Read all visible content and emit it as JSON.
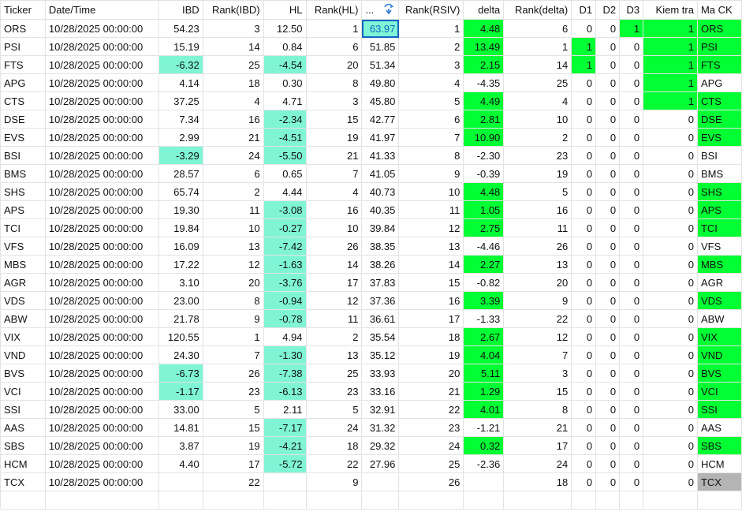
{
  "colors": {
    "teal": "#7ff5d6",
    "green": "#00ff33",
    "gray": "#b4b4b4",
    "selected_text": "#1565c0"
  },
  "headers": [
    "Ticker",
    "Date/Time",
    "IBD",
    "Rank(IBD)",
    "HL",
    "Rank(HL)",
    "...",
    "Rank(RSIV)",
    "delta",
    "Rank(delta)",
    "D1",
    "D2",
    "D3",
    "Kiem tra",
    "Ma CK"
  ],
  "sort_icon": "sort-descending-icon",
  "rows": [
    {
      "ticker": "ORS",
      "date": "10/28/2025 00:00:00",
      "ibd": "54.23",
      "rank_ibd": "3",
      "hl": "12.50",
      "rank_hl": "1",
      "rsiv": "63.97",
      "rank_rsiv": "1",
      "delta": "4.48",
      "rank_delta": "6",
      "d1": "0",
      "d2": "0",
      "d3": "1",
      "kiem_tra": "1",
      "ma_ck": "ORS",
      "hl_ibd": "",
      "hl_hl": "",
      "hl_delta": "green",
      "hl_d1": "",
      "hl_d3": "green",
      "hl_kiem": "green",
      "hl_mack": "green",
      "rsiv_selected": true
    },
    {
      "ticker": "PSI",
      "date": "10/28/2025 00:00:00",
      "ibd": "15.19",
      "rank_ibd": "14",
      "hl": "0.84",
      "rank_hl": "6",
      "rsiv": "51.85",
      "rank_rsiv": "2",
      "delta": "13.49",
      "rank_delta": "1",
      "d1": "1",
      "d2": "0",
      "d3": "0",
      "kiem_tra": "1",
      "ma_ck": "PSI",
      "hl_ibd": "",
      "hl_hl": "",
      "hl_delta": "green",
      "hl_d1": "green",
      "hl_d3": "",
      "hl_kiem": "green",
      "hl_mack": "green",
      "rsiv_selected": false
    },
    {
      "ticker": "FTS",
      "date": "10/28/2025 00:00:00",
      "ibd": "-6.32",
      "rank_ibd": "25",
      "hl": "-4.54",
      "rank_hl": "20",
      "rsiv": "51.34",
      "rank_rsiv": "3",
      "delta": "2.15",
      "rank_delta": "14",
      "d1": "1",
      "d2": "0",
      "d3": "0",
      "kiem_tra": "1",
      "ma_ck": "FTS",
      "hl_ibd": "teal",
      "hl_hl": "teal",
      "hl_delta": "green",
      "hl_d1": "green",
      "hl_d3": "",
      "hl_kiem": "green",
      "hl_mack": "green",
      "rsiv_selected": false
    },
    {
      "ticker": "APG",
      "date": "10/28/2025 00:00:00",
      "ibd": "4.14",
      "rank_ibd": "18",
      "hl": "0.30",
      "rank_hl": "8",
      "rsiv": "49.80",
      "rank_rsiv": "4",
      "delta": "-4.35",
      "rank_delta": "25",
      "d1": "0",
      "d2": "0",
      "d3": "0",
      "kiem_tra": "1",
      "ma_ck": "APG",
      "hl_ibd": "",
      "hl_hl": "",
      "hl_delta": "",
      "hl_d1": "",
      "hl_d3": "",
      "hl_kiem": "green",
      "hl_mack": "",
      "rsiv_selected": false
    },
    {
      "ticker": "CTS",
      "date": "10/28/2025 00:00:00",
      "ibd": "37.25",
      "rank_ibd": "4",
      "hl": "4.71",
      "rank_hl": "3",
      "rsiv": "45.80",
      "rank_rsiv": "5",
      "delta": "4.49",
      "rank_delta": "4",
      "d1": "0",
      "d2": "0",
      "d3": "0",
      "kiem_tra": "1",
      "ma_ck": "CTS",
      "hl_ibd": "",
      "hl_hl": "",
      "hl_delta": "green",
      "hl_d1": "",
      "hl_d3": "",
      "hl_kiem": "green",
      "hl_mack": "green",
      "rsiv_selected": false
    },
    {
      "ticker": "DSE",
      "date": "10/28/2025 00:00:00",
      "ibd": "7.34",
      "rank_ibd": "16",
      "hl": "-2.34",
      "rank_hl": "15",
      "rsiv": "42.77",
      "rank_rsiv": "6",
      "delta": "2.81",
      "rank_delta": "10",
      "d1": "0",
      "d2": "0",
      "d3": "0",
      "kiem_tra": "0",
      "ma_ck": "DSE",
      "hl_ibd": "",
      "hl_hl": "teal",
      "hl_delta": "green",
      "hl_d1": "",
      "hl_d3": "",
      "hl_kiem": "",
      "hl_mack": "green",
      "rsiv_selected": false
    },
    {
      "ticker": "EVS",
      "date": "10/28/2025 00:00:00",
      "ibd": "2.99",
      "rank_ibd": "21",
      "hl": "-4.51",
      "rank_hl": "19",
      "rsiv": "41.97",
      "rank_rsiv": "7",
      "delta": "10.90",
      "rank_delta": "2",
      "d1": "0",
      "d2": "0",
      "d3": "0",
      "kiem_tra": "0",
      "ma_ck": "EVS",
      "hl_ibd": "",
      "hl_hl": "teal",
      "hl_delta": "green",
      "hl_d1": "",
      "hl_d3": "",
      "hl_kiem": "",
      "hl_mack": "green",
      "rsiv_selected": false
    },
    {
      "ticker": "BSI",
      "date": "10/28/2025 00:00:00",
      "ibd": "-3.29",
      "rank_ibd": "24",
      "hl": "-5.50",
      "rank_hl": "21",
      "rsiv": "41.33",
      "rank_rsiv": "8",
      "delta": "-2.30",
      "rank_delta": "23",
      "d1": "0",
      "d2": "0",
      "d3": "0",
      "kiem_tra": "0",
      "ma_ck": "BSI",
      "hl_ibd": "teal",
      "hl_hl": "teal",
      "hl_delta": "",
      "hl_d1": "",
      "hl_d3": "",
      "hl_kiem": "",
      "hl_mack": "",
      "rsiv_selected": false
    },
    {
      "ticker": "BMS",
      "date": "10/28/2025 00:00:00",
      "ibd": "28.57",
      "rank_ibd": "6",
      "hl": "0.65",
      "rank_hl": "7",
      "rsiv": "41.05",
      "rank_rsiv": "9",
      "delta": "-0.39",
      "rank_delta": "19",
      "d1": "0",
      "d2": "0",
      "d3": "0",
      "kiem_tra": "0",
      "ma_ck": "BMS",
      "hl_ibd": "",
      "hl_hl": "",
      "hl_delta": "",
      "hl_d1": "",
      "hl_d3": "",
      "hl_kiem": "",
      "hl_mack": "",
      "rsiv_selected": false
    },
    {
      "ticker": "SHS",
      "date": "10/28/2025 00:00:00",
      "ibd": "65.74",
      "rank_ibd": "2",
      "hl": "4.44",
      "rank_hl": "4",
      "rsiv": "40.73",
      "rank_rsiv": "10",
      "delta": "4.48",
      "rank_delta": "5",
      "d1": "0",
      "d2": "0",
      "d3": "0",
      "kiem_tra": "0",
      "ma_ck": "SHS",
      "hl_ibd": "",
      "hl_hl": "",
      "hl_delta": "green",
      "hl_d1": "",
      "hl_d3": "",
      "hl_kiem": "",
      "hl_mack": "green",
      "rsiv_selected": false
    },
    {
      "ticker": "APS",
      "date": "10/28/2025 00:00:00",
      "ibd": "19.30",
      "rank_ibd": "11",
      "hl": "-3.08",
      "rank_hl": "16",
      "rsiv": "40.35",
      "rank_rsiv": "11",
      "delta": "1.05",
      "rank_delta": "16",
      "d1": "0",
      "d2": "0",
      "d3": "0",
      "kiem_tra": "0",
      "ma_ck": "APS",
      "hl_ibd": "",
      "hl_hl": "teal",
      "hl_delta": "green",
      "hl_d1": "",
      "hl_d3": "",
      "hl_kiem": "",
      "hl_mack": "green",
      "rsiv_selected": false
    },
    {
      "ticker": "TCI",
      "date": "10/28/2025 00:00:00",
      "ibd": "19.84",
      "rank_ibd": "10",
      "hl": "-0.27",
      "rank_hl": "10",
      "rsiv": "39.84",
      "rank_rsiv": "12",
      "delta": "2.75",
      "rank_delta": "11",
      "d1": "0",
      "d2": "0",
      "d3": "0",
      "kiem_tra": "0",
      "ma_ck": "TCI",
      "hl_ibd": "",
      "hl_hl": "teal",
      "hl_delta": "green",
      "hl_d1": "",
      "hl_d3": "",
      "hl_kiem": "",
      "hl_mack": "green",
      "rsiv_selected": false
    },
    {
      "ticker": "VFS",
      "date": "10/28/2025 00:00:00",
      "ibd": "16.09",
      "rank_ibd": "13",
      "hl": "-7.42",
      "rank_hl": "26",
      "rsiv": "38.35",
      "rank_rsiv": "13",
      "delta": "-4.46",
      "rank_delta": "26",
      "d1": "0",
      "d2": "0",
      "d3": "0",
      "kiem_tra": "0",
      "ma_ck": "VFS",
      "hl_ibd": "",
      "hl_hl": "teal",
      "hl_delta": "",
      "hl_d1": "",
      "hl_d3": "",
      "hl_kiem": "",
      "hl_mack": "",
      "rsiv_selected": false
    },
    {
      "ticker": "MBS",
      "date": "10/28/2025 00:00:00",
      "ibd": "17.22",
      "rank_ibd": "12",
      "hl": "-1.63",
      "rank_hl": "14",
      "rsiv": "38.26",
      "rank_rsiv": "14",
      "delta": "2.27",
      "rank_delta": "13",
      "d1": "0",
      "d2": "0",
      "d3": "0",
      "kiem_tra": "0",
      "ma_ck": "MBS",
      "hl_ibd": "",
      "hl_hl": "teal",
      "hl_delta": "green",
      "hl_d1": "",
      "hl_d3": "",
      "hl_kiem": "",
      "hl_mack": "green",
      "rsiv_selected": false
    },
    {
      "ticker": "AGR",
      "date": "10/28/2025 00:00:00",
      "ibd": "3.10",
      "rank_ibd": "20",
      "hl": "-3.76",
      "rank_hl": "17",
      "rsiv": "37.83",
      "rank_rsiv": "15",
      "delta": "-0.82",
      "rank_delta": "20",
      "d1": "0",
      "d2": "0",
      "d3": "0",
      "kiem_tra": "0",
      "ma_ck": "AGR",
      "hl_ibd": "",
      "hl_hl": "teal",
      "hl_delta": "",
      "hl_d1": "",
      "hl_d3": "",
      "hl_kiem": "",
      "hl_mack": "",
      "rsiv_selected": false
    },
    {
      "ticker": "VDS",
      "date": "10/28/2025 00:00:00",
      "ibd": "23.00",
      "rank_ibd": "8",
      "hl": "-0.94",
      "rank_hl": "12",
      "rsiv": "37.36",
      "rank_rsiv": "16",
      "delta": "3.39",
      "rank_delta": "9",
      "d1": "0",
      "d2": "0",
      "d3": "0",
      "kiem_tra": "0",
      "ma_ck": "VDS",
      "hl_ibd": "",
      "hl_hl": "teal",
      "hl_delta": "green",
      "hl_d1": "",
      "hl_d3": "",
      "hl_kiem": "",
      "hl_mack": "green",
      "rsiv_selected": false
    },
    {
      "ticker": "ABW",
      "date": "10/28/2025 00:00:00",
      "ibd": "21.78",
      "rank_ibd": "9",
      "hl": "-0.78",
      "rank_hl": "11",
      "rsiv": "36.61",
      "rank_rsiv": "17",
      "delta": "-1.33",
      "rank_delta": "22",
      "d1": "0",
      "d2": "0",
      "d3": "0",
      "kiem_tra": "0",
      "ma_ck": "ABW",
      "hl_ibd": "",
      "hl_hl": "teal",
      "hl_delta": "",
      "hl_d1": "",
      "hl_d3": "",
      "hl_kiem": "",
      "hl_mack": "",
      "rsiv_selected": false
    },
    {
      "ticker": "VIX",
      "date": "10/28/2025 00:00:00",
      "ibd": "120.55",
      "rank_ibd": "1",
      "hl": "4.94",
      "rank_hl": "2",
      "rsiv": "35.54",
      "rank_rsiv": "18",
      "delta": "2.67",
      "rank_delta": "12",
      "d1": "0",
      "d2": "0",
      "d3": "0",
      "kiem_tra": "0",
      "ma_ck": "VIX",
      "hl_ibd": "",
      "hl_hl": "",
      "hl_delta": "green",
      "hl_d1": "",
      "hl_d3": "",
      "hl_kiem": "",
      "hl_mack": "green",
      "rsiv_selected": false
    },
    {
      "ticker": "VND",
      "date": "10/28/2025 00:00:00",
      "ibd": "24.30",
      "rank_ibd": "7",
      "hl": "-1.30",
      "rank_hl": "13",
      "rsiv": "35.12",
      "rank_rsiv": "19",
      "delta": "4.04",
      "rank_delta": "7",
      "d1": "0",
      "d2": "0",
      "d3": "0",
      "kiem_tra": "0",
      "ma_ck": "VND",
      "hl_ibd": "",
      "hl_hl": "teal",
      "hl_delta": "green",
      "hl_d1": "",
      "hl_d3": "",
      "hl_kiem": "",
      "hl_mack": "green",
      "rsiv_selected": false
    },
    {
      "ticker": "BVS",
      "date": "10/28/2025 00:00:00",
      "ibd": "-6.73",
      "rank_ibd": "26",
      "hl": "-7.38",
      "rank_hl": "25",
      "rsiv": "33.93",
      "rank_rsiv": "20",
      "delta": "5.11",
      "rank_delta": "3",
      "d1": "0",
      "d2": "0",
      "d3": "0",
      "kiem_tra": "0",
      "ma_ck": "BVS",
      "hl_ibd": "teal",
      "hl_hl": "teal",
      "hl_delta": "green",
      "hl_d1": "",
      "hl_d3": "",
      "hl_kiem": "",
      "hl_mack": "green",
      "rsiv_selected": false
    },
    {
      "ticker": "VCI",
      "date": "10/28/2025 00:00:00",
      "ibd": "-1.17",
      "rank_ibd": "23",
      "hl": "-6.13",
      "rank_hl": "23",
      "rsiv": "33.16",
      "rank_rsiv": "21",
      "delta": "1.29",
      "rank_delta": "15",
      "d1": "0",
      "d2": "0",
      "d3": "0",
      "kiem_tra": "0",
      "ma_ck": "VCI",
      "hl_ibd": "teal",
      "hl_hl": "teal",
      "hl_delta": "green",
      "hl_d1": "",
      "hl_d3": "",
      "hl_kiem": "",
      "hl_mack": "green",
      "rsiv_selected": false
    },
    {
      "ticker": "SSI",
      "date": "10/28/2025 00:00:00",
      "ibd": "33.00",
      "rank_ibd": "5",
      "hl": "2.11",
      "rank_hl": "5",
      "rsiv": "32.91",
      "rank_rsiv": "22",
      "delta": "4.01",
      "rank_delta": "8",
      "d1": "0",
      "d2": "0",
      "d3": "0",
      "kiem_tra": "0",
      "ma_ck": "SSI",
      "hl_ibd": "",
      "hl_hl": "",
      "hl_delta": "green",
      "hl_d1": "",
      "hl_d3": "",
      "hl_kiem": "",
      "hl_mack": "green",
      "rsiv_selected": false
    },
    {
      "ticker": "AAS",
      "date": "10/28/2025 00:00:00",
      "ibd": "14.81",
      "rank_ibd": "15",
      "hl": "-7.17",
      "rank_hl": "24",
      "rsiv": "31.32",
      "rank_rsiv": "23",
      "delta": "-1.21",
      "rank_delta": "21",
      "d1": "0",
      "d2": "0",
      "d3": "0",
      "kiem_tra": "0",
      "ma_ck": "AAS",
      "hl_ibd": "",
      "hl_hl": "teal",
      "hl_delta": "",
      "hl_d1": "",
      "hl_d3": "",
      "hl_kiem": "",
      "hl_mack": "",
      "rsiv_selected": false
    },
    {
      "ticker": "SBS",
      "date": "10/28/2025 00:00:00",
      "ibd": "3.87",
      "rank_ibd": "19",
      "hl": "-4.21",
      "rank_hl": "18",
      "rsiv": "29.32",
      "rank_rsiv": "24",
      "delta": "0.32",
      "rank_delta": "17",
      "d1": "0",
      "d2": "0",
      "d3": "0",
      "kiem_tra": "0",
      "ma_ck": "SBS",
      "hl_ibd": "",
      "hl_hl": "teal",
      "hl_delta": "green",
      "hl_d1": "",
      "hl_d3": "",
      "hl_kiem": "",
      "hl_mack": "green",
      "rsiv_selected": false
    },
    {
      "ticker": "HCM",
      "date": "10/28/2025 00:00:00",
      "ibd": "4.40",
      "rank_ibd": "17",
      "hl": "-5.72",
      "rank_hl": "22",
      "rsiv": "27.96",
      "rank_rsiv": "25",
      "delta": "-2.36",
      "rank_delta": "24",
      "d1": "0",
      "d2": "0",
      "d3": "0",
      "kiem_tra": "0",
      "ma_ck": "HCM",
      "hl_ibd": "",
      "hl_hl": "teal",
      "hl_delta": "",
      "hl_d1": "",
      "hl_d3": "",
      "hl_kiem": "",
      "hl_mack": "",
      "rsiv_selected": false
    },
    {
      "ticker": "TCX",
      "date": "10/28/2025 00:00:00",
      "ibd": "",
      "rank_ibd": "22",
      "hl": "",
      "rank_hl": "9",
      "rsiv": "",
      "rank_rsiv": "26",
      "delta": "",
      "rank_delta": "18",
      "d1": "0",
      "d2": "0",
      "d3": "0",
      "kiem_tra": "0",
      "ma_ck": "TCX",
      "hl_ibd": "",
      "hl_hl": "",
      "hl_delta": "",
      "hl_d1": "",
      "hl_d3": "",
      "hl_kiem": "",
      "hl_mack": "gray",
      "rsiv_selected": false
    }
  ]
}
